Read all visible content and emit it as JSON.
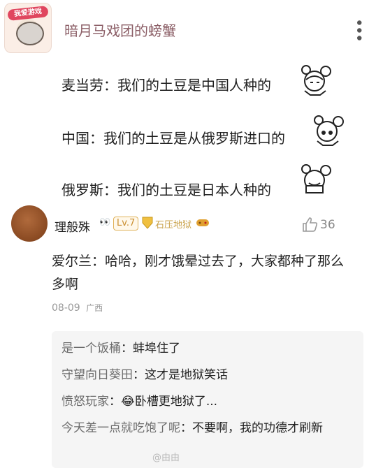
{
  "post": {
    "avatar_badge": "我爱游戏",
    "author": "暗月马戏团的螃蟹",
    "lines": [
      "麦当劳：我们的土豆是中国人种的",
      "中国：我们的土豆是从俄罗斯进口的",
      "俄罗斯：我们的土豆是日本人种的"
    ]
  },
  "comment": {
    "name": "理般殊",
    "eyes": "👀",
    "level": "Lv.7",
    "title": "石压地狱",
    "likes": "36",
    "text": "爱尔兰：哈哈，刚才饿晕过去了，大家都种了那么多啊",
    "date": "08-09",
    "location": "广西"
  },
  "replies": [
    {
      "name": "是一个饭桶",
      "text": "蚌埠住了"
    },
    {
      "name": "守望向日葵田",
      "text": "这才是地狱笑话"
    },
    {
      "name": "愤怒玩家",
      "text": "😂卧槽更地狱了..."
    },
    {
      "name": "今天差一点就吃饱了呢",
      "text": "不要啊，我的功德才刷新"
    }
  ],
  "watermark": "@由由"
}
